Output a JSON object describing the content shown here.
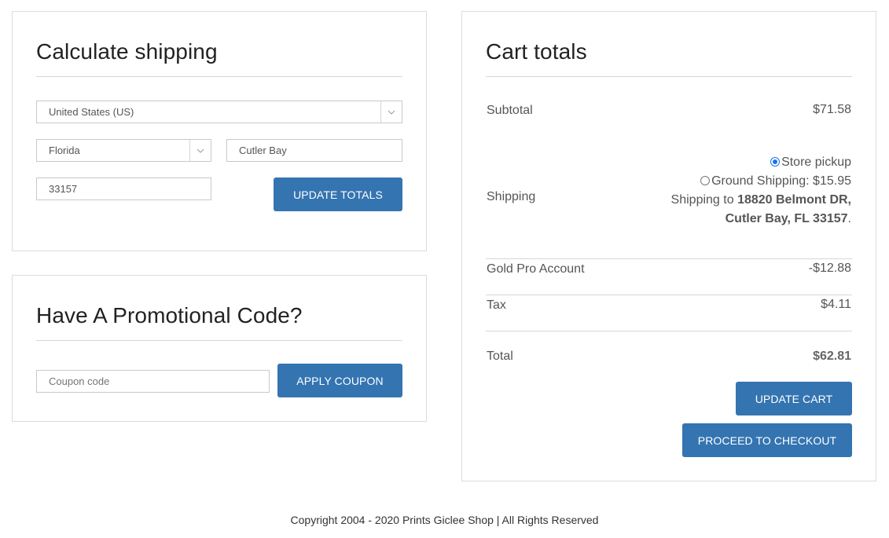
{
  "shipping_calc": {
    "title": "Calculate shipping",
    "country": "United States (US)",
    "state": "Florida",
    "city": "Cutler Bay",
    "zip": "33157",
    "update_totals_label": "UPDATE TOTALS"
  },
  "promo": {
    "title": "Have A Promotional Code?",
    "coupon_placeholder": "Coupon code",
    "apply_label": "APPLY COUPON"
  },
  "cart_totals": {
    "title": "Cart totals",
    "subtotal_label": "Subtotal",
    "subtotal_value": "$71.58",
    "shipping_label": "Shipping",
    "shipping_options": [
      {
        "label": "Store pickup",
        "selected": true
      },
      {
        "label": "Ground Shipping: $15.95",
        "selected": false
      }
    ],
    "shipping_to_prefix": "Shipping to ",
    "shipping_address_line1": "18820 Belmont DR,",
    "shipping_address_line2": "Cutler Bay, FL 33157",
    "shipping_address_suffix": ".",
    "discount_label": "Gold Pro Account",
    "discount_value": "-$12.88",
    "tax_label": "Tax",
    "tax_value": "$4.11",
    "total_label": "Total",
    "total_value": "$62.81",
    "update_cart_label": "UPDATE CART",
    "checkout_label": "PROCEED TO CHECKOUT"
  },
  "footer": {
    "copyright": "Copyright 2004 - 2020 Prints Giclee Shop | All Rights Reserved"
  },
  "colors": {
    "button": "#3474b1",
    "border": "#dcdcdc"
  }
}
